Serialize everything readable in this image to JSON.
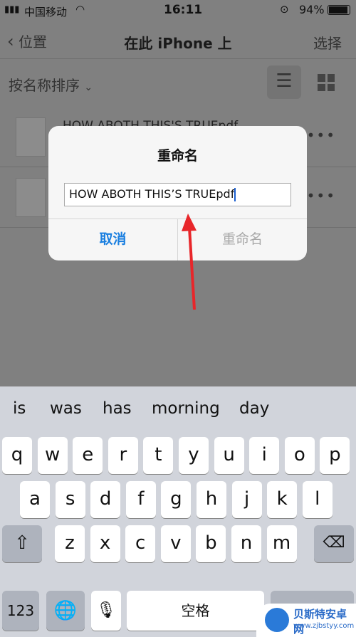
{
  "status": {
    "carrier": "中国移动",
    "time": "16:11",
    "battery": "94%"
  },
  "nav": {
    "back": "位置",
    "title": "在此 iPhone 上",
    "select": "选择"
  },
  "sort": {
    "label": "按名称排序"
  },
  "files": [
    {
      "name": "HOW ABOTH THIS'S TRUEpdf"
    },
    {
      "name": ""
    }
  ],
  "dialog": {
    "title": "重命名",
    "value": "HOW ABOTH THIS’S TRUEpdf",
    "cancel": "取消",
    "confirm": "重命名"
  },
  "keyboard": {
    "suggestions": [
      "is",
      "was",
      "has",
      "morning",
      "day"
    ],
    "row1": [
      "q",
      "w",
      "e",
      "r",
      "t",
      "y",
      "u",
      "i",
      "o",
      "p"
    ],
    "row2": [
      "a",
      "s",
      "d",
      "f",
      "g",
      "h",
      "j",
      "k",
      "l"
    ],
    "row3": [
      "z",
      "x",
      "c",
      "v",
      "b",
      "n",
      "m"
    ],
    "numbers": "123",
    "space": "空格"
  },
  "watermark": {
    "name": "贝斯特安卓网",
    "url": "www.zjbstyy.com"
  },
  "colors": {
    "accent": "#1a7fe0",
    "arrow": "#e8262a"
  }
}
